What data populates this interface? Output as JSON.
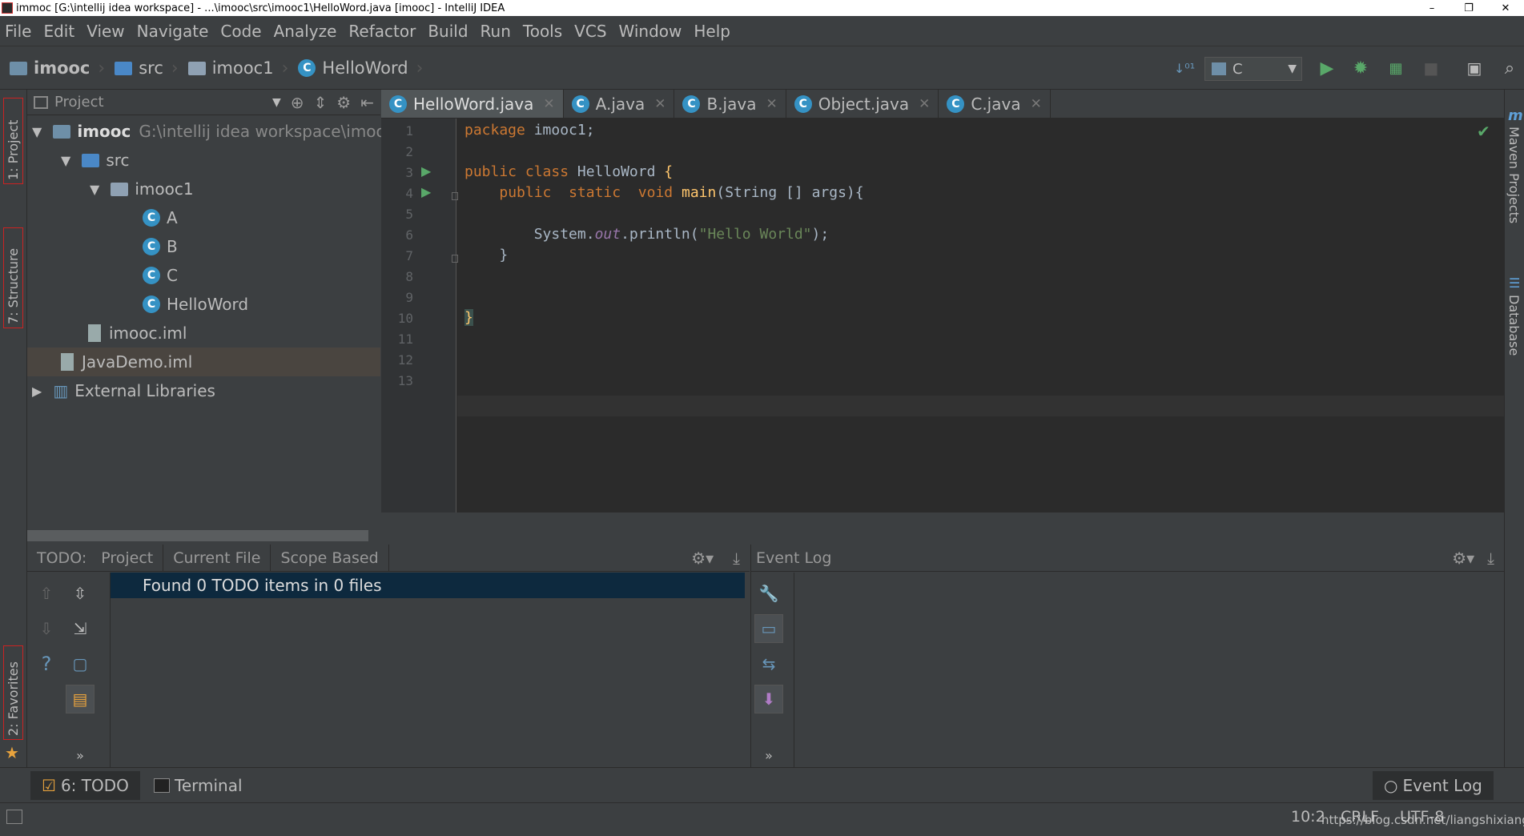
{
  "window": {
    "title": "immoc [G:\\intellij idea workspace] - ...\\imooc\\src\\imooc1\\HelloWord.java [imooc] - IntelliJ IDEA"
  },
  "menu": [
    "File",
    "Edit",
    "View",
    "Navigate",
    "Code",
    "Analyze",
    "Refactor",
    "Build",
    "Run",
    "Tools",
    "VCS",
    "Window",
    "Help"
  ],
  "breadcrumb": {
    "project": "imooc",
    "src": "src",
    "pkg": "imooc1",
    "file": "HelloWord"
  },
  "run_config": "C",
  "side_tabs": {
    "project": "1: Project",
    "structure": "7: Structure",
    "favorites": "2: Favorites",
    "maven": "Maven Projects",
    "database": "Database"
  },
  "project_panel": {
    "title": "Project",
    "tree": {
      "root": "imooc",
      "root_path": "G:\\intellij idea workspace\\imooc",
      "src": "src",
      "pkg": "imooc1",
      "classes": [
        "A",
        "B",
        "C",
        "HelloWord"
      ],
      "imooc_iml": "imooc.iml",
      "javademo_iml": "JavaDemo.iml",
      "ext_libs": "External Libraries"
    }
  },
  "editor": {
    "tabs": [
      "HelloWord.java",
      "A.java",
      "B.java",
      "Object.java",
      "C.java"
    ],
    "line_numbers": [
      "1",
      "2",
      "3",
      "4",
      "5",
      "6",
      "7",
      "8",
      "9",
      "10",
      "11",
      "12",
      "13"
    ],
    "code": {
      "l1_kw": "package",
      "l1_rest": " imooc1;",
      "l3_kw": "public class",
      "l3_name": " HelloWord ",
      "l3_brace": "{",
      "l4_kw1": "public",
      "l4_kw2": "static",
      "l4_kw3": "void",
      "l4_fn": "main",
      "l4_rest": "(String [] args){",
      "l6_a": "System.",
      "l6_out": "out",
      "l6_b": ".println(",
      "l6_str": "\"Hello World\"",
      "l6_c": ");",
      "l7": "}",
      "l10": "}"
    }
  },
  "todo": {
    "label": "TODO:",
    "tabs": [
      "Project",
      "Current File",
      "Scope Based"
    ],
    "found": "Found 0 TODO items in 0 files"
  },
  "event_log": {
    "title": "Event Log"
  },
  "bottom": {
    "todo": "6: TODO",
    "terminal": "Terminal",
    "event_log": "Event Log"
  },
  "status": {
    "position": "10:2",
    "line_sep": "CRLF",
    "encoding": "UTF-8",
    "watermark": "https://blog.csdn.net/liangshixiang"
  }
}
